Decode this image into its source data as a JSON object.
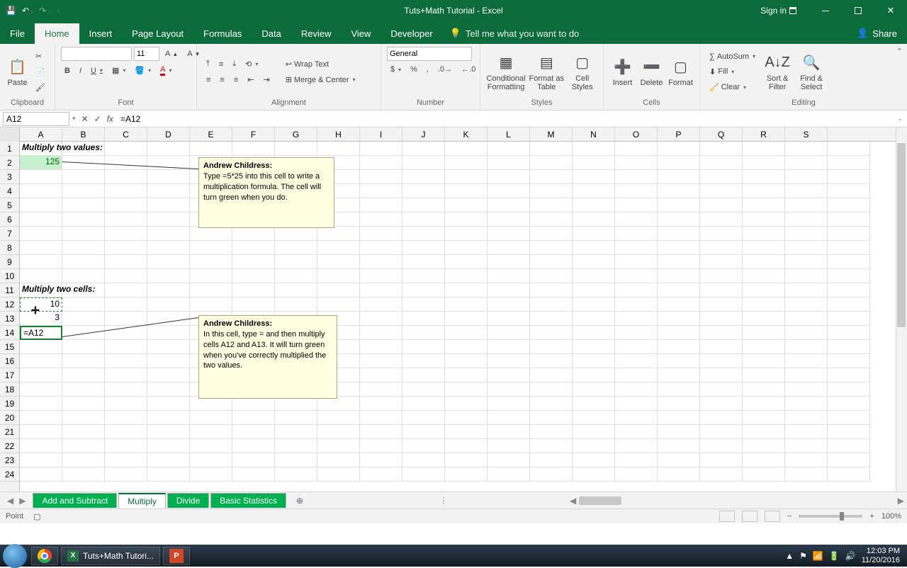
{
  "title": "Tuts+Math Tutorial - Excel",
  "signin": "Sign in",
  "tabs": {
    "file": "File",
    "home": "Home",
    "insert": "Insert",
    "pagelayout": "Page Layout",
    "formulas": "Formulas",
    "data": "Data",
    "review": "Review",
    "view": "View",
    "developer": "Developer",
    "tell": "Tell me what you want to do",
    "share": "Share"
  },
  "ribbon": {
    "clipboard": {
      "label": "Clipboard",
      "paste": "Paste"
    },
    "font": {
      "label": "Font",
      "size": "11",
      "b": "B",
      "i": "I",
      "u": "U"
    },
    "alignment": {
      "label": "Alignment",
      "wrap": "Wrap Text",
      "merge": "Merge & Center"
    },
    "number": {
      "label": "Number",
      "general": "General"
    },
    "styles": {
      "label": "Styles",
      "cond": "Conditional Formatting",
      "fmtTable": "Format as Table",
      "cellStyles": "Cell Styles"
    },
    "cells": {
      "label": "Cells",
      "insert": "Insert",
      "delete": "Delete",
      "format": "Format"
    },
    "editing": {
      "label": "Editing",
      "autosum": "AutoSum",
      "fill": "Fill",
      "clear": "Clear",
      "sort": "Sort & Filter",
      "find": "Find & Select"
    }
  },
  "formula_bar": {
    "name_box": "A12",
    "formula": "=A12"
  },
  "columns": [
    "A",
    "B",
    "C",
    "D",
    "E",
    "F",
    "G",
    "H",
    "I",
    "J",
    "K",
    "L",
    "M",
    "N",
    "O",
    "P",
    "Q",
    "R",
    "S"
  ],
  "rows": [
    "1",
    "2",
    "3",
    "4",
    "5",
    "6",
    "7",
    "8",
    "9",
    "10",
    "11",
    "12",
    "13",
    "14",
    "15",
    "16",
    "17",
    "18",
    "19",
    "20",
    "21",
    "22",
    "23",
    "24"
  ],
  "cells": {
    "A1": "Multiply two values:",
    "A2": "125",
    "A11": "Multiply two cells:",
    "A12": "10",
    "A13": "3",
    "A14": "=A12"
  },
  "comments": {
    "c1": {
      "author": "Andrew Childress:",
      "text": "Type =5*25 into this cell to write a multiplication formula. The cell will turn green when you do."
    },
    "c2": {
      "author": "Andrew Childress:",
      "text": "In this cell, type = and then multiply cells A12 and A13. It will turn green when you've correctly multiplied the two values."
    }
  },
  "sheet_tabs": {
    "t1": "Add and Subtract",
    "t2": "Multiply",
    "t3": "Divide",
    "t4": "Basic Statistics"
  },
  "status": {
    "mode": "Point",
    "zoom": "100%"
  },
  "taskbar": {
    "app1": "Tuts+Math Tutori...",
    "time": "12:03 PM",
    "date": "11/20/2016"
  }
}
